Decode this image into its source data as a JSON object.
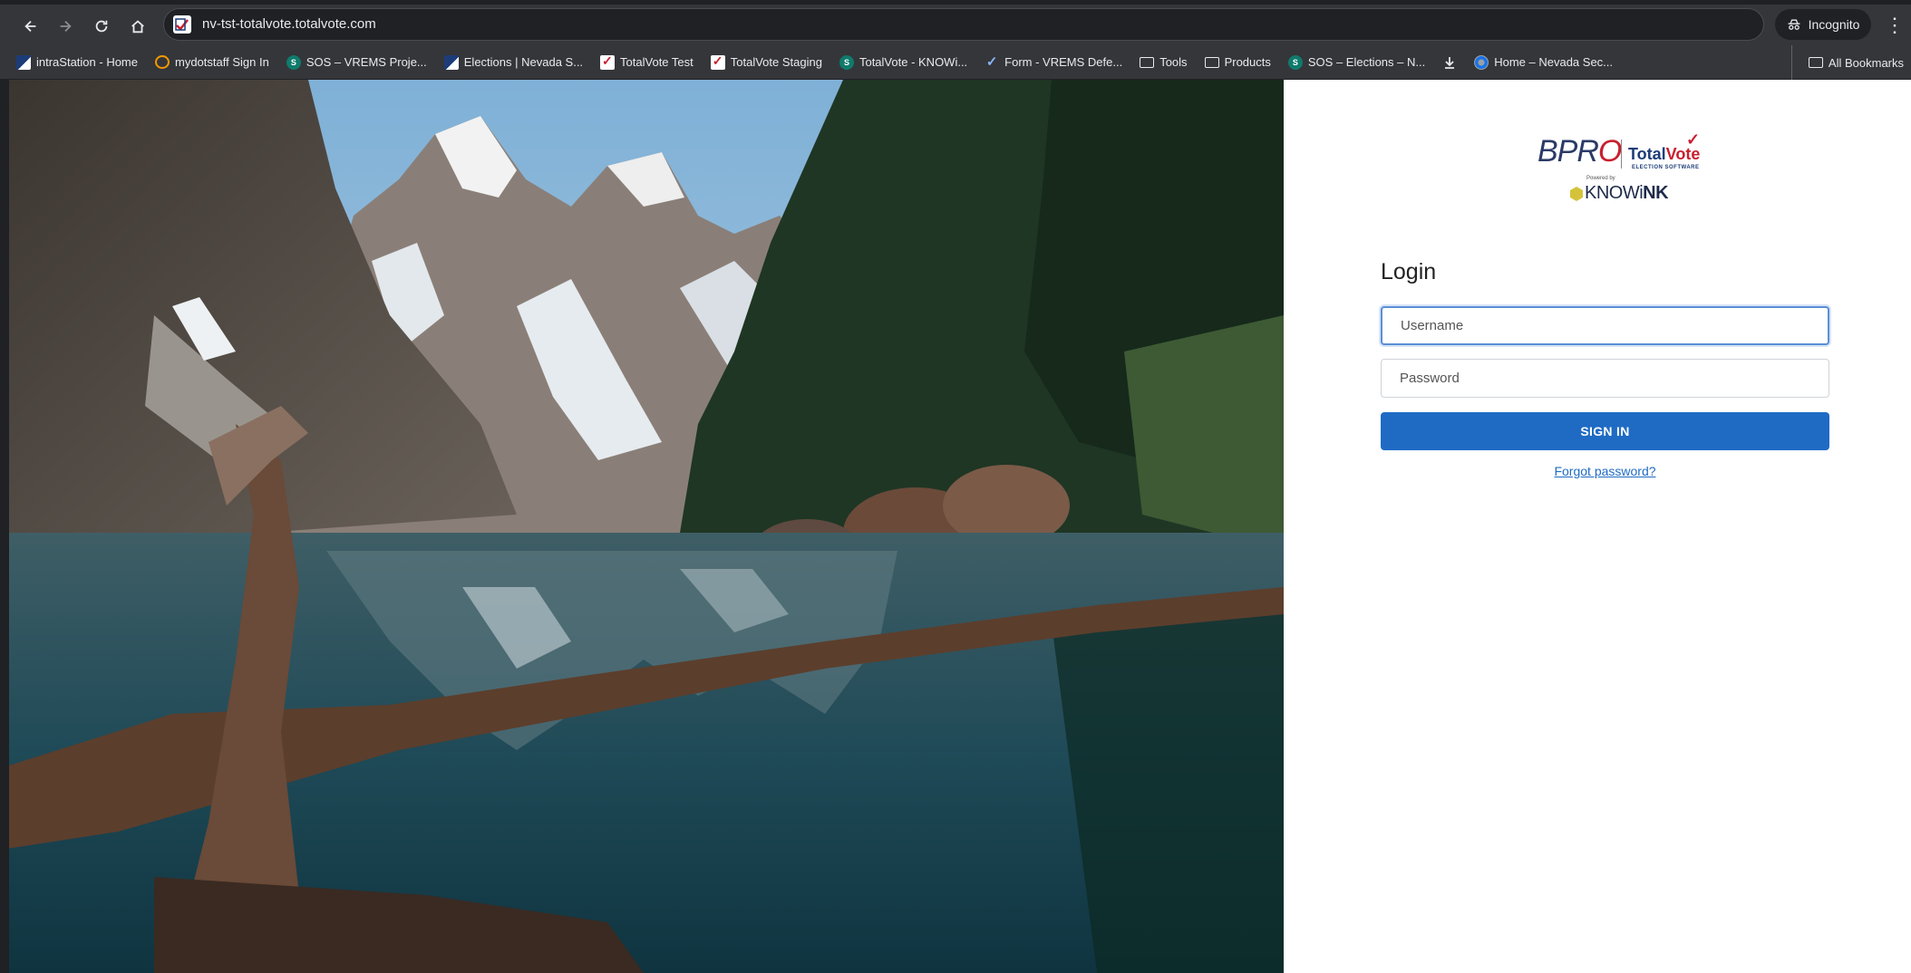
{
  "browser": {
    "url": "nv-tst-totalvote.totalvote.com",
    "incognito_label": "Incognito",
    "bookmarks": [
      {
        "label": "intraStation - Home",
        "icon": "flag-icon"
      },
      {
        "label": "mydotstaff Sign In",
        "icon": "ring-icon"
      },
      {
        "label": "SOS – VREMS Proje...",
        "icon": "sharepoint-icon"
      },
      {
        "label": "Elections | Nevada S...",
        "icon": "flag-icon"
      },
      {
        "label": "TotalVote Test",
        "icon": "totalvote-icon"
      },
      {
        "label": "TotalVote Staging",
        "icon": "totalvote-icon"
      },
      {
        "label": "TotalVote - KNOWi...",
        "icon": "sharepoint-icon"
      },
      {
        "label": "Form - VREMS Defe...",
        "icon": "check-icon"
      },
      {
        "label": "Tools",
        "icon": "folder-icon"
      },
      {
        "label": "Products",
        "icon": "folder-icon"
      },
      {
        "label": "SOS – Elections – N...",
        "icon": "sharepoint-icon"
      },
      {
        "label": "",
        "icon": "download-icon"
      },
      {
        "label": "Home – Nevada Sec...",
        "icon": "seal-icon"
      }
    ],
    "all_bookmarks_label": "All Bookmarks"
  },
  "logo": {
    "bpro_prefix": "BPR",
    "bpro_o": "O",
    "totalvote_a": "Total",
    "totalvote_b": "Vote",
    "totalvote_sub": "ELECTION SOFTWARE",
    "powered_by": "Powered by",
    "knowink_a": "KNOWi",
    "knowink_b": "NK"
  },
  "login": {
    "title": "Login",
    "username_placeholder": "Username",
    "password_placeholder": "Password",
    "signin_label": "SIGN IN",
    "forgot_label": "Forgot password?"
  },
  "colors": {
    "primary": "#1f6bc4",
    "chrome": "#35363a"
  }
}
